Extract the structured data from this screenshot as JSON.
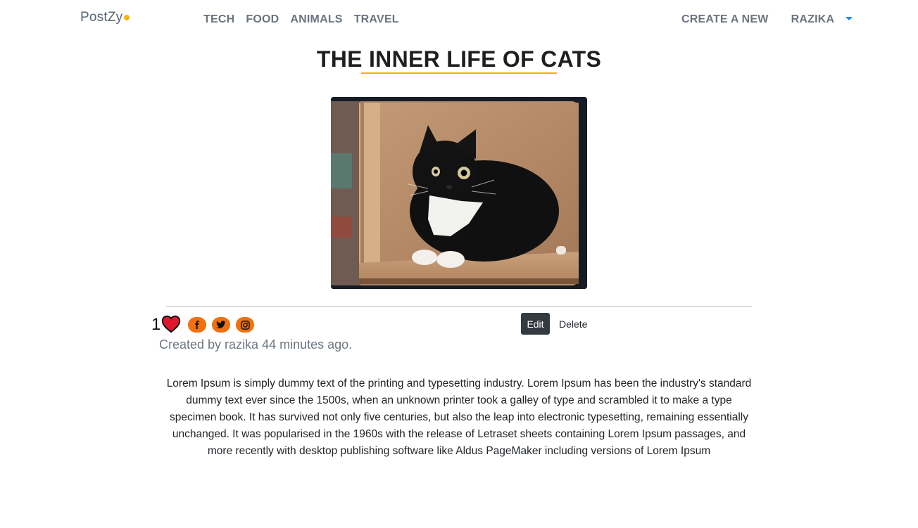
{
  "brand": {
    "name": "PostZy",
    "dot_color": "#f5b400"
  },
  "nav": {
    "items": [
      "TECH",
      "FOOD",
      "ANIMALS",
      "TRAVEL"
    ]
  },
  "right_nav": {
    "create_label": "CREATE A NEW",
    "user_label": "RAZIKA"
  },
  "post": {
    "title": "THE INNER LIFE OF CATS",
    "like_count": "1",
    "created_text": "Created by razika 44 minutes ago.",
    "body": "Lorem Ipsum is simply dummy text of the printing and typesetting industry. Lorem Ipsum has been the industry's standard dummy text ever since the 1500s, when an unknown printer took a galley of type and scrambled it to make a type specimen book. It has survived not only five centuries, but also the leap into electronic typesetting, remaining essentially unchanged. It was popularised in the 1960s with the release of Letraset sheets containing Lorem Ipsum passages, and more recently with desktop publishing software like Aldus PageMaker including versions of Lorem Ipsum"
  },
  "actions": {
    "edit_label": "Edit",
    "delete_label": "Delete"
  },
  "icons": {
    "heart": "heart-icon",
    "facebook": "facebook-icon",
    "twitter": "twitter-icon",
    "instagram": "instagram-icon",
    "dropdown": "chevron-down-icon"
  },
  "colors": {
    "accent": "#f5b400",
    "social": "#f2700d",
    "heart": "#e0182d",
    "dark_button": "#343a40",
    "link_blue": "#1e86ff"
  }
}
